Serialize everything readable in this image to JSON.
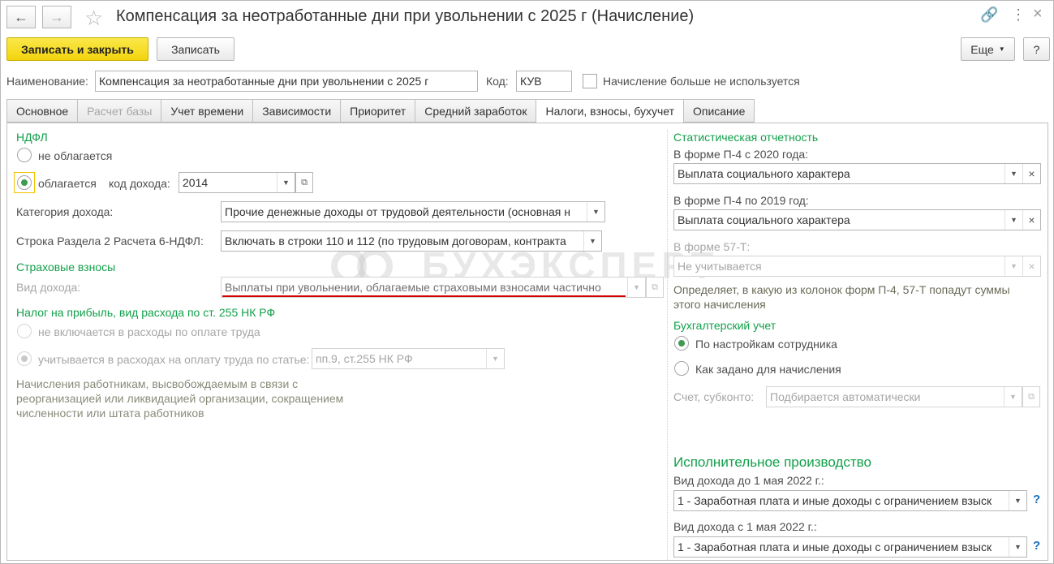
{
  "window": {
    "title": "Компенсация за неотработанные дни при увольнении с 2025 г (Начисление)"
  },
  "icons": {
    "back": "arrow-left-icon",
    "forward": "arrow-right-icon",
    "favorite": "star-icon",
    "link": "link-icon",
    "more": "more-vert-icon",
    "close": "close-icon"
  },
  "toolbar": {
    "save_close_label": "Записать и закрыть",
    "save_label": "Записать",
    "more_label": "Еще",
    "help_label": "?"
  },
  "header": {
    "name_label": "Наименование:",
    "name_value": "Компенсация за неотработанные дни при увольнении с 2025 г",
    "code_label": "Код:",
    "code_value": "КУВ",
    "unused_label": "Начисление больше не используется",
    "unused_checked": false
  },
  "tabs": [
    {
      "label": "Основное",
      "state": "normal"
    },
    {
      "label": "Расчет базы",
      "state": "disabled"
    },
    {
      "label": "Учет времени",
      "state": "normal"
    },
    {
      "label": "Зависимости",
      "state": "normal"
    },
    {
      "label": "Приоритет",
      "state": "normal"
    },
    {
      "label": "Средний заработок",
      "state": "normal"
    },
    {
      "label": "Налоги, взносы, бухучет",
      "state": "active"
    },
    {
      "label": "Описание",
      "state": "normal"
    }
  ],
  "ndfl": {
    "section_title": "НДФЛ",
    "not_taxed_label": "не облагается",
    "taxed_label": "облагается",
    "income_code_label": "код дохода:",
    "income_code_value": "2014",
    "income_category_label": "Категория дохода:",
    "income_category_value": "Прочие денежные доходы от трудовой деятельности (основная н",
    "line_label": "Строка Раздела 2 Расчета 6-НДФЛ:",
    "line_value": "Включать в строки 110 и 112 (по трудовым договорам, контракта"
  },
  "insurance": {
    "section_title": "Страховые взносы",
    "income_type_label": "Вид дохода:",
    "income_type_value": "Выплаты при увольнении, облагаемые страховыми взносами частично"
  },
  "profit_tax": {
    "section_title": "Налог на прибыль, вид расхода по ст. 255 НК РФ",
    "not_included_label": "не включается в расходы по оплате труда",
    "included_label": "учитывается в расходах на оплату труда по статье:",
    "article_value": "пп.9, ст.255 НК РФ",
    "note": "Начисления работникам, высвобождаемым в связи с реорганизацией или ликвидацией организации, сокращением численности или штата работников"
  },
  "stats": {
    "section_title": "Статистическая отчетность",
    "p4_2020_label": "В форме П-4 с 2020 года:",
    "p4_2020_value": "Выплата социального характера",
    "p4_2019_label": "В форме П-4 по 2019 год:",
    "p4_2019_value": "Выплата социального характера",
    "f57t_label": "В форме 57-Т:",
    "f57t_value": "Не учитывается",
    "note": "Определяет, в какую из колонок форм П-4, 57-Т попадут суммы этого начисления"
  },
  "accounting": {
    "section_title": "Бухгалтерский учет",
    "by_employee_label": "По настройкам сотрудника",
    "as_set_label": "Как задано для начисления",
    "account_label": "Счет, субконто:",
    "account_placeholder": "Подбирается автоматически"
  },
  "enforcement": {
    "section_title": "Исполнительное производство",
    "before_label": "Вид дохода до 1 мая 2022 г.:",
    "before_value": "1 - Заработная плата и иные доходы с ограничением взыск",
    "after_label": "Вид дохода с 1 мая 2022 г.:",
    "after_value": "1 - Заработная плата и иные доходы с ограничением взыск"
  },
  "watermark": {
    "text": "БУХЭКСПЕРТ"
  }
}
